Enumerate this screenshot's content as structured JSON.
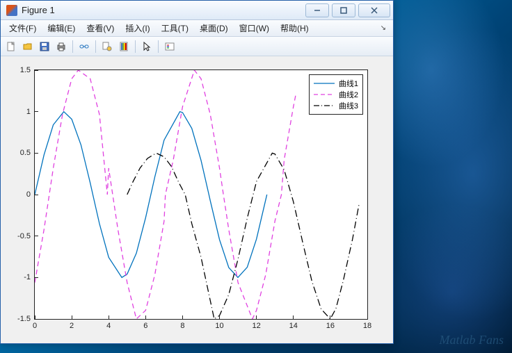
{
  "watermark": "Matlab Fans",
  "window": {
    "title": "Figure 1",
    "min_tip": "—",
    "max_tip": "❐",
    "close_tip": "✕"
  },
  "menu": {
    "file": "文件(F)",
    "edit": "编辑(E)",
    "view": "查看(V)",
    "insert": "插入(I)",
    "tools": "工具(T)",
    "desktop": "桌面(D)",
    "window_m": "窗口(W)",
    "help": "帮助(H)"
  },
  "toolbar": {
    "new": "new",
    "open": "open",
    "save": "save",
    "print": "print",
    "link": "link",
    "datacursor": "datacursor",
    "insertcb": "insertcb",
    "arrow": "arrow",
    "insertlegend": "insertlegend"
  },
  "chart_data": {
    "type": "line",
    "xlim": [
      0,
      18
    ],
    "ylim": [
      -1.5,
      1.5
    ],
    "xticks": [
      0,
      2,
      4,
      6,
      8,
      10,
      12,
      14,
      16,
      18
    ],
    "yticks": [
      -1.5,
      -1,
      -0.5,
      0,
      0.5,
      1,
      1.5
    ],
    "xlabel": "",
    "ylabel": "",
    "title": "",
    "legend": {
      "position": "northeast",
      "entries": [
        "曲线1",
        "曲线2",
        "曲线3"
      ]
    },
    "series": [
      {
        "name": "曲线1",
        "color": "#0072bd",
        "dash": "solid",
        "x_start": 0,
        "x_end": 12.566,
        "formula": "sin(x)",
        "values": [
          [
            0,
            0
          ],
          [
            0.5,
            0.479
          ],
          [
            1,
            0.841
          ],
          [
            1.571,
            1
          ],
          [
            2,
            0.909
          ],
          [
            2.5,
            0.599
          ],
          [
            3,
            0.141
          ],
          [
            3.1416,
            0
          ],
          [
            3.5,
            -0.351
          ],
          [
            4,
            -0.757
          ],
          [
            4.712,
            -1
          ],
          [
            5,
            -0.959
          ],
          [
            5.5,
            -0.706
          ],
          [
            6,
            -0.279
          ],
          [
            6.2832,
            0
          ],
          [
            6.5,
            0.215
          ],
          [
            7,
            0.657
          ],
          [
            7.854,
            1
          ],
          [
            8,
            0.989
          ],
          [
            8.5,
            0.798
          ],
          [
            9,
            0.412
          ],
          [
            9.4248,
            0
          ],
          [
            9.5,
            -0.075
          ],
          [
            10,
            -0.544
          ],
          [
            10.5,
            -0.88
          ],
          [
            10.996,
            -1
          ],
          [
            11.5,
            -0.876
          ],
          [
            12,
            -0.537
          ],
          [
            12.566,
            0
          ]
        ]
      },
      {
        "name": "曲线2",
        "color": "#e040e0",
        "dash": "dashed",
        "x_start": 0,
        "x_end": 14.137,
        "formula": "1.5*sin(x - pi/4)",
        "values": [
          [
            0,
            -1.061
          ],
          [
            0.5,
            -0.421
          ],
          [
            0.785,
            0
          ],
          [
            1,
            0.319
          ],
          [
            1.5,
            0.966
          ],
          [
            2,
            1.397
          ],
          [
            2.356,
            1.5
          ],
          [
            3,
            1.397
          ],
          [
            3.5,
            0.966
          ],
          [
            3.927,
            0
          ],
          [
            4,
            0.319
          ],
          [
            4.5,
            -0.421
          ],
          [
            5,
            -1.061
          ],
          [
            5.498,
            -1.5
          ],
          [
            6,
            -1.397
          ],
          [
            6.5,
            -0.966
          ],
          [
            7,
            -0.319
          ],
          [
            7.069,
            0
          ],
          [
            7.5,
            0.421
          ],
          [
            8,
            1.061
          ],
          [
            8.639,
            1.5
          ],
          [
            9,
            1.397
          ],
          [
            9.5,
            0.966
          ],
          [
            10,
            0.319
          ],
          [
            10.21,
            0
          ],
          [
            10.5,
            -0.421
          ],
          [
            11,
            -1.061
          ],
          [
            11.78,
            -1.5
          ],
          [
            12,
            -1.397
          ],
          [
            12.5,
            -0.966
          ],
          [
            13,
            -0.319
          ],
          [
            13.35,
            0
          ],
          [
            13.5,
            0.421
          ],
          [
            14,
            1.061
          ],
          [
            14.137,
            1.216
          ]
        ]
      },
      {
        "name": "曲线3",
        "color": "#000000",
        "dash": "dashdot",
        "x_start": 5,
        "x_end": 17.566,
        "formula": "0.5 - 2*sin((x-5)/2)^2 = cos(x-5) - 0.5 stretched",
        "values": [
          [
            5,
            0
          ],
          [
            5.3,
            0.148
          ],
          [
            5.7,
            0.321
          ],
          [
            6.1,
            0.436
          ],
          [
            6.571,
            0.5
          ],
          [
            7,
            0.455
          ],
          [
            7.4,
            0.338
          ],
          [
            7.8,
            0.142
          ],
          [
            8.1416,
            0
          ],
          [
            8.5,
            -0.351
          ],
          [
            9,
            -0.757
          ],
          [
            9.712,
            -1.5
          ],
          [
            10,
            -1.459
          ],
          [
            10.5,
            -1.206
          ],
          [
            11,
            -0.779
          ],
          [
            11.2832,
            -0.5
          ],
          [
            11.5,
            -0.285
          ],
          [
            12,
            0.157
          ],
          [
            12.854,
            0.5
          ],
          [
            13,
            0.489
          ],
          [
            13.5,
            0.298
          ],
          [
            14,
            -0.088
          ],
          [
            14.4248,
            -0.5
          ],
          [
            14.5,
            -0.575
          ],
          [
            15,
            -1.044
          ],
          [
            15.5,
            -1.38
          ],
          [
            15.996,
            -1.5
          ],
          [
            16.3,
            -1.376
          ],
          [
            16.7,
            -1.037
          ],
          [
            17.2,
            -0.537
          ],
          [
            17.566,
            -0.1
          ]
        ]
      }
    ]
  }
}
